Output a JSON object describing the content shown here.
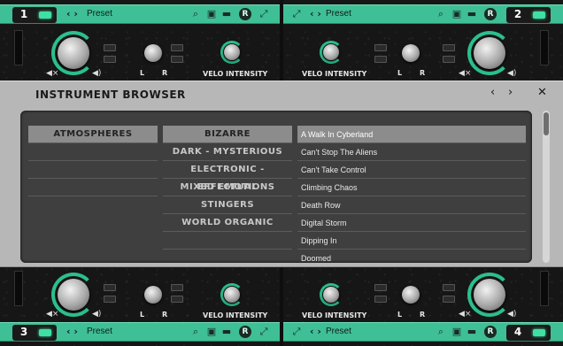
{
  "slots": [
    {
      "number": "1",
      "preset": "Preset",
      "velo_label": "VELO INTENSITY",
      "l": "L",
      "r": "R"
    },
    {
      "number": "2",
      "preset": "Preset",
      "velo_label": "VELO INTENSITY",
      "l": "L",
      "r": "R"
    },
    {
      "number": "3",
      "preset": "Preset",
      "velo_label": "VELO INTENSITY",
      "l": "L",
      "r": "R"
    },
    {
      "number": "4",
      "preset": "Preset",
      "velo_label": "VELO INTENSITY",
      "l": "L",
      "r": "R"
    }
  ],
  "toolbar": {
    "arrows": "‹ ›",
    "r_button": "R"
  },
  "browser": {
    "title": "INSTRUMENT BROWSER",
    "column1": [
      "ATMOSPHERES"
    ],
    "column2": [
      "BIZARRE",
      "DARK - MYSTERIOUS",
      "ELECTRONIC - EFFECTUAL",
      "MIXED EMOTIONS",
      "STINGERS",
      "WORLD ORGANIC"
    ],
    "instruments": [
      "A Walk In Cyberland",
      "Can't Stop The Aliens",
      "Can't Take Control",
      "Climbing Chaos",
      "Death Row",
      "Digital Storm",
      "Dipping In",
      "Doomed"
    ]
  },
  "colors": {
    "accent": "#3fbf95",
    "browser_bg": "#b7b7b7",
    "list_bg": "#3f3f3f",
    "selection": "#8c8c8c"
  }
}
